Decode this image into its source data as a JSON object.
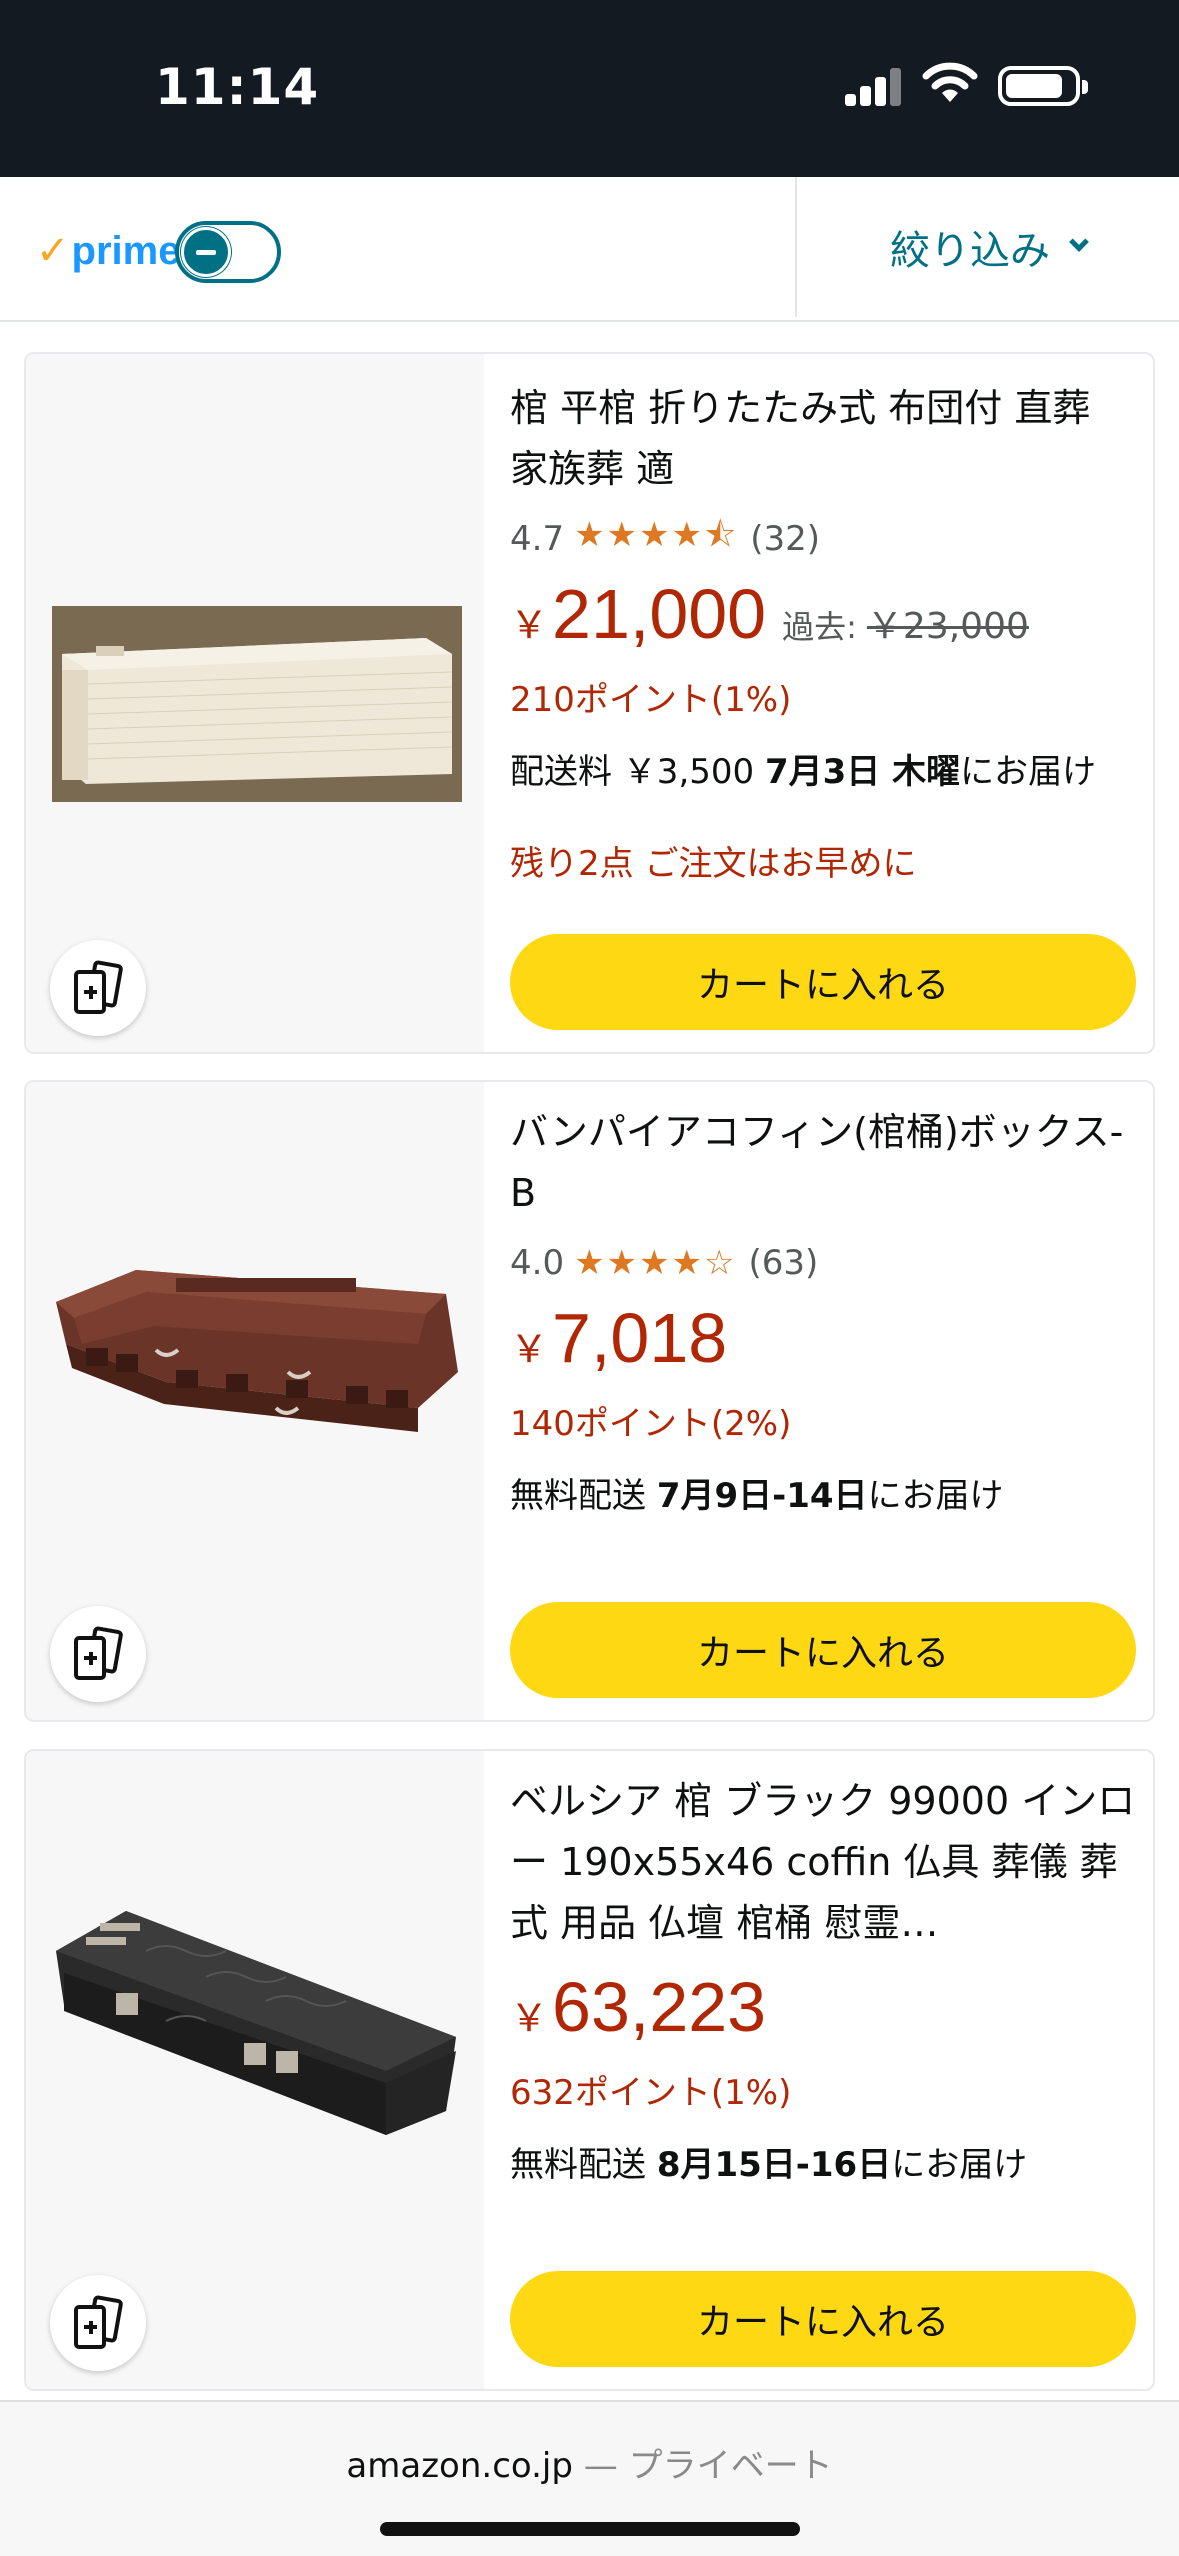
{
  "status_bar": {
    "time": "11:14"
  },
  "filter_bar": {
    "prime_check": "✓",
    "prime_label": "prime",
    "prime_toggle_on": false,
    "filter_label": "絞り込み"
  },
  "products": [
    {
      "title": "棺 平棺 折りたたみ式 布団付 直葬 家族葬 適",
      "rating": "4.7",
      "stars": "★★★★⯪",
      "review_count": "(32)",
      "price_symbol": "￥",
      "price": "21,000",
      "was_label": "過去:",
      "was_price": "￥23,000",
      "points": "210ポイント(1%)",
      "delivery_prefix": "配送料 ￥3,500 ",
      "delivery_date": "7月3日 木曜",
      "delivery_suffix": "にお届け",
      "stock_warning": "残り2点 ご注文はお早めに",
      "cart_label": "カートに入れる"
    },
    {
      "title": "バンパイアコフィン(棺桶)ボックス-B",
      "rating": "4.0",
      "stars": "★★★★☆",
      "review_count": "(63)",
      "price_symbol": "￥",
      "price": "7,018",
      "points": "140ポイント(2%)",
      "delivery_prefix": "無料配送 ",
      "delivery_date": "7月9日-14日",
      "delivery_suffix": "にお届け",
      "cart_label": "カートに入れる"
    },
    {
      "title": "ベルシア 棺 ブラック 99000 インロー 190x55x46 coffin 仏具 葬儀 葬式 用品 仏壇 棺桶 慰霊…",
      "price_symbol": "￥",
      "price": "63,223",
      "points": "632ポイント(1%)",
      "delivery_prefix": "無料配送 ",
      "delivery_date": "8月15日-16日",
      "delivery_suffix": "にお届け",
      "cart_label": "カートに入れる"
    }
  ],
  "bottom_bar": {
    "domain": "amazon.co.jp",
    "separator": " — ",
    "mode": "プライベート"
  },
  "colors": {
    "status_bar_bg": "#131a22",
    "accent_teal": "#007185",
    "price_red": "#b12704",
    "cart_yellow": "#ffd814",
    "star_orange": "#de7921"
  },
  "icons": [
    "signal-icon",
    "wifi-icon",
    "battery-icon",
    "prime-check-icon",
    "chevron-down-icon",
    "compare-icon"
  ]
}
